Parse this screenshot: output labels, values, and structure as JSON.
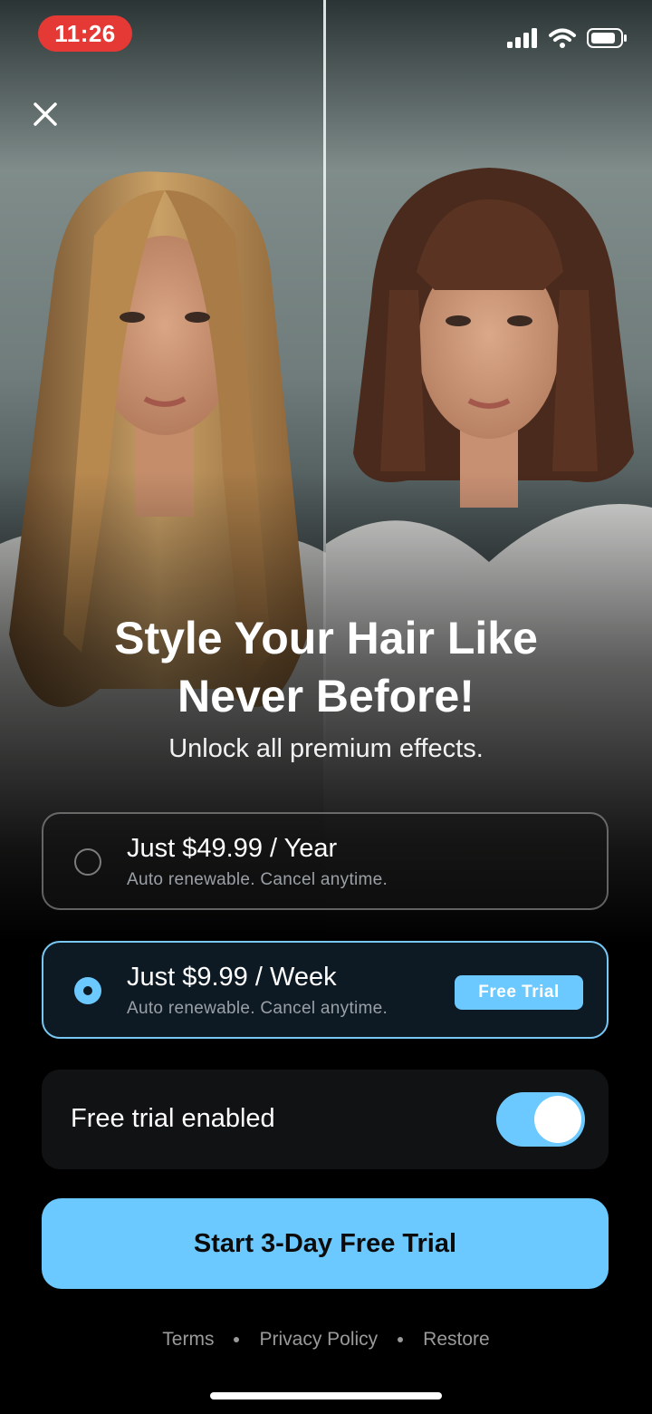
{
  "status_bar": {
    "time": "11:26",
    "icons": [
      "cellular-signal-icon",
      "wifi-icon",
      "battery-icon"
    ]
  },
  "hero": {
    "images": [
      "before-hair-photo-long-blonde",
      "after-hair-photo-brown-bob"
    ]
  },
  "headline": {
    "line1": "Style Your Hair Like",
    "line2": "Never Before!",
    "subtitle": "Unlock all premium effects."
  },
  "plans": [
    {
      "title": "Just $49.99 / Year",
      "subtitle": "Auto renewable. Cancel anytime.",
      "selected": false
    },
    {
      "title": "Just $9.99 / Week",
      "subtitle": "Auto renewable. Cancel anytime.",
      "selected": true,
      "badge": "Free Trial"
    }
  ],
  "trial_toggle": {
    "label": "Free trial enabled",
    "enabled": true
  },
  "cta": {
    "label": "Start 3-Day Free Trial"
  },
  "footer": {
    "terms": "Terms",
    "privacy": "Privacy Policy",
    "restore": "Restore"
  },
  "colors": {
    "accent": "#6cc9ff",
    "time_pill": "#e53935",
    "background": "#000000"
  }
}
